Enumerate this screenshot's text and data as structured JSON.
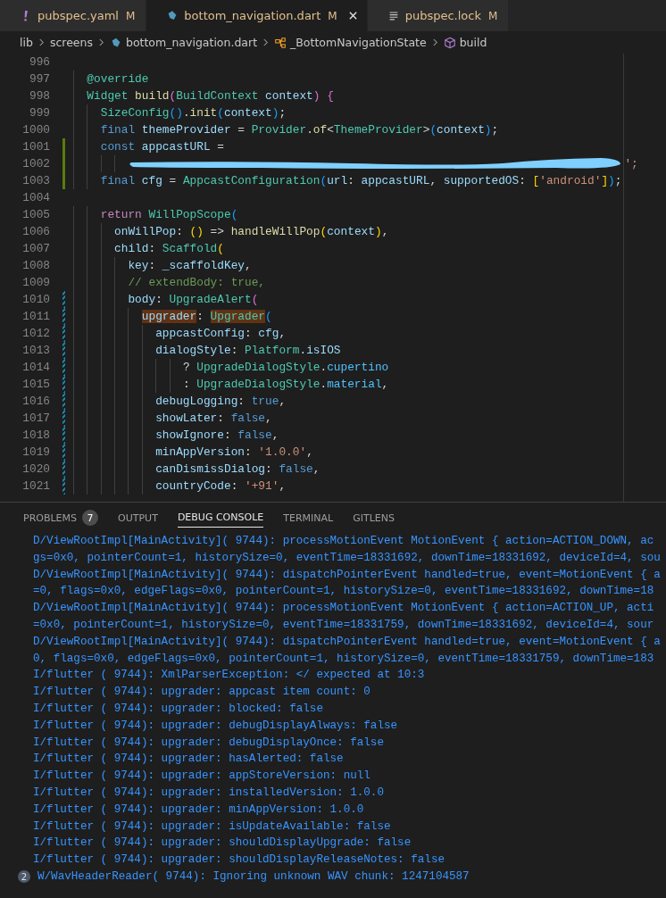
{
  "tabs": [
    {
      "label": "pubspec.yaml",
      "kind": "yaml",
      "status": "M",
      "selected": false
    },
    {
      "label": "bottom_navigation.dart",
      "kind": "dart",
      "status": "M",
      "selected": true
    },
    {
      "label": "pubspec.lock",
      "kind": "lock",
      "status": "M",
      "selected": false
    }
  ],
  "breadcrumbs": [
    {
      "label": "lib"
    },
    {
      "label": "screens"
    },
    {
      "label": "bottom_navigation.dart",
      "kind": "dart"
    },
    {
      "label": "_BottomNavigationState",
      "kind": "class"
    },
    {
      "label": "build",
      "kind": "method"
    }
  ],
  "editor": {
    "lines": [
      {
        "number": "996"
      },
      {
        "number": "997",
        "tokens": [
          {
            "text": "  @override",
            "kind": "type"
          }
        ]
      },
      {
        "number": "998",
        "tokens": [
          {
            "text": "  Widget",
            "kind": "type"
          },
          {
            "text": " build",
            "kind": "fn"
          },
          {
            "text": "(",
            "kind": "b2"
          },
          {
            "text": "BuildContext",
            "kind": "type"
          },
          {
            "text": " context",
            "kind": "var"
          },
          {
            "text": ")",
            "kind": "b2"
          },
          {
            "text": " {",
            "kind": "b2"
          }
        ]
      },
      {
        "number": "999",
        "tokens": [
          {
            "text": "    SizeConfig",
            "kind": "type"
          },
          {
            "text": "()",
            "kind": "b3"
          },
          {
            "text": ".",
            "kind": "plain"
          },
          {
            "text": "init",
            "kind": "fn"
          },
          {
            "text": "(",
            "kind": "b3"
          },
          {
            "text": "context",
            "kind": "var"
          },
          {
            "text": ")",
            "kind": "b3"
          },
          {
            "text": ";",
            "kind": "plain"
          }
        ]
      },
      {
        "number": "1000",
        "tokens": [
          {
            "text": "    final",
            "kind": "kw"
          },
          {
            "text": " themeProvider",
            "kind": "var"
          },
          {
            "text": " = ",
            "kind": "plain"
          },
          {
            "text": "Provider",
            "kind": "type"
          },
          {
            "text": ".",
            "kind": "plain"
          },
          {
            "text": "of",
            "kind": "fn"
          },
          {
            "text": "<",
            "kind": "plain"
          },
          {
            "text": "ThemeProvider",
            "kind": "type"
          },
          {
            "text": ">",
            "kind": "plain"
          },
          {
            "text": "(",
            "kind": "b3"
          },
          {
            "text": "context",
            "kind": "var"
          },
          {
            "text": ")",
            "kind": "b3"
          },
          {
            "text": ";",
            "kind": "plain"
          }
        ]
      },
      {
        "number": "1001",
        "kind": "added",
        "tokens": [
          {
            "text": "    const",
            "kind": "kw"
          },
          {
            "text": " appcastURL",
            "kind": "var"
          },
          {
            "text": " =",
            "kind": "plain"
          }
        ]
      },
      {
        "number": "1002",
        "kind": "added",
        "redacted": true,
        "tokens": [
          {
            "text": "        ';",
            "kind": "str"
          }
        ]
      },
      {
        "number": "1003",
        "kind": "added",
        "tokens": [
          {
            "text": "    final",
            "kind": "kw"
          },
          {
            "text": " cfg",
            "kind": "var"
          },
          {
            "text": " = ",
            "kind": "plain"
          },
          {
            "text": "AppcastConfiguration",
            "kind": "type"
          },
          {
            "text": "(",
            "kind": "b3"
          },
          {
            "text": "url",
            "kind": "var"
          },
          {
            "text": ": ",
            "kind": "plain"
          },
          {
            "text": "appcastURL",
            "kind": "var"
          },
          {
            "text": ", ",
            "kind": "plain"
          },
          {
            "text": "supportedOS",
            "kind": "var"
          },
          {
            "text": ": ",
            "kind": "plain"
          },
          {
            "text": "[",
            "kind": "b1"
          },
          {
            "text": "'android'",
            "kind": "str"
          },
          {
            "text": "]",
            "kind": "b1"
          },
          {
            "text": ")",
            "kind": "b3"
          },
          {
            "text": ";",
            "kind": "plain"
          }
        ]
      },
      {
        "number": "1004"
      },
      {
        "number": "1005",
        "tokens": [
          {
            "text": "    return",
            "kind": "ctrl"
          },
          {
            "text": " WillPopScope",
            "kind": "type"
          },
          {
            "text": "(",
            "kind": "b3"
          }
        ]
      },
      {
        "number": "1006",
        "tokens": [
          {
            "text": "      onWillPop",
            "kind": "var"
          },
          {
            "text": ": ",
            "kind": "plain"
          },
          {
            "text": "()",
            "kind": "b1"
          },
          {
            "text": " => ",
            "kind": "plain"
          },
          {
            "text": "handleWillPop",
            "kind": "fn"
          },
          {
            "text": "(",
            "kind": "b1"
          },
          {
            "text": "context",
            "kind": "var"
          },
          {
            "text": ")",
            "kind": "b1"
          },
          {
            "text": ",",
            "kind": "plain"
          }
        ]
      },
      {
        "number": "1007",
        "tokens": [
          {
            "text": "      child",
            "kind": "var"
          },
          {
            "text": ": ",
            "kind": "plain"
          },
          {
            "text": "Scaffold",
            "kind": "type"
          },
          {
            "text": "(",
            "kind": "b1"
          }
        ]
      },
      {
        "number": "1008",
        "tokens": [
          {
            "text": "        key",
            "kind": "var"
          },
          {
            "text": ": ",
            "kind": "plain"
          },
          {
            "text": "_scaffoldKey",
            "kind": "var"
          },
          {
            "text": ",",
            "kind": "plain"
          }
        ]
      },
      {
        "number": "1009",
        "tokens": [
          {
            "text": "        // extendBody: true,",
            "kind": "cmt"
          }
        ]
      },
      {
        "number": "1010",
        "kind": "modified",
        "tokens": [
          {
            "text": "        body",
            "kind": "var"
          },
          {
            "text": ": ",
            "kind": "plain"
          },
          {
            "text": "UpgradeAlert",
            "kind": "type"
          },
          {
            "text": "(",
            "kind": "b2"
          }
        ]
      },
      {
        "number": "1011",
        "kind": "modified",
        "tokens": [
          {
            "text": "          upgrader",
            "kind": "var",
            "highlight": true
          },
          {
            "text": ": ",
            "kind": "plain"
          },
          {
            "text": "Upgrader",
            "kind": "type",
            "highlight": true
          },
          {
            "text": "(",
            "kind": "b3"
          }
        ]
      },
      {
        "number": "1012",
        "kind": "modified",
        "tokens": [
          {
            "text": "            appcastConfig",
            "kind": "var"
          },
          {
            "text": ": ",
            "kind": "plain"
          },
          {
            "text": "cfg",
            "kind": "var"
          },
          {
            "text": ",",
            "kind": "plain"
          }
        ]
      },
      {
        "number": "1013",
        "kind": "modified",
        "tokens": [
          {
            "text": "            dialogStyle",
            "kind": "var"
          },
          {
            "text": ": ",
            "kind": "plain"
          },
          {
            "text": "Platform",
            "kind": "type"
          },
          {
            "text": ".",
            "kind": "plain"
          },
          {
            "text": "isIOS",
            "kind": "var"
          }
        ]
      },
      {
        "number": "1014",
        "kind": "modified",
        "tokens": [
          {
            "text": "                ? ",
            "kind": "plain"
          },
          {
            "text": "UpgradeDialogStyle",
            "kind": "type"
          },
          {
            "text": ".",
            "kind": "plain"
          },
          {
            "text": "cupertino",
            "kind": "prop"
          }
        ]
      },
      {
        "number": "1015",
        "kind": "modified",
        "tokens": [
          {
            "text": "                : ",
            "kind": "plain"
          },
          {
            "text": "UpgradeDialogStyle",
            "kind": "type"
          },
          {
            "text": ".",
            "kind": "plain"
          },
          {
            "text": "material",
            "kind": "prop"
          },
          {
            "text": ",",
            "kind": "plain"
          }
        ]
      },
      {
        "number": "1016",
        "kind": "modified",
        "tokens": [
          {
            "text": "            debugLogging",
            "kind": "var"
          },
          {
            "text": ": ",
            "kind": "plain"
          },
          {
            "text": "true",
            "kind": "kw"
          },
          {
            "text": ",",
            "kind": "plain"
          }
        ]
      },
      {
        "number": "1017",
        "kind": "modified",
        "tokens": [
          {
            "text": "            showLater",
            "kind": "var"
          },
          {
            "text": ": ",
            "kind": "plain"
          },
          {
            "text": "false",
            "kind": "kw"
          },
          {
            "text": ",",
            "kind": "plain"
          }
        ]
      },
      {
        "number": "1018",
        "kind": "modified",
        "tokens": [
          {
            "text": "            showIgnore",
            "kind": "var"
          },
          {
            "text": ": ",
            "kind": "plain"
          },
          {
            "text": "false",
            "kind": "kw"
          },
          {
            "text": ",",
            "kind": "plain"
          }
        ]
      },
      {
        "number": "1019",
        "kind": "modified",
        "tokens": [
          {
            "text": "            minAppVersion",
            "kind": "var"
          },
          {
            "text": ": ",
            "kind": "plain"
          },
          {
            "text": "'1.0.0'",
            "kind": "str"
          },
          {
            "text": ",",
            "kind": "plain"
          }
        ]
      },
      {
        "number": "1020",
        "kind": "modified",
        "tokens": [
          {
            "text": "            canDismissDialog",
            "kind": "var"
          },
          {
            "text": ": ",
            "kind": "plain"
          },
          {
            "text": "false",
            "kind": "kw"
          },
          {
            "text": ",",
            "kind": "plain"
          }
        ]
      },
      {
        "number": "1021",
        "kind": "modified",
        "tokens": [
          {
            "text": "            countryCode",
            "kind": "var"
          },
          {
            "text": ": ",
            "kind": "plain"
          },
          {
            "text": "'+91'",
            "kind": "str"
          },
          {
            "text": ",",
            "kind": "plain"
          }
        ]
      }
    ]
  },
  "panel": {
    "tabs": [
      {
        "label": "PROBLEMS",
        "badge": "7",
        "selected": false
      },
      {
        "label": "OUTPUT",
        "selected": false
      },
      {
        "label": "DEBUG CONSOLE",
        "selected": true
      },
      {
        "label": "TERMINAL",
        "selected": false
      },
      {
        "label": "GITLENS",
        "selected": false
      }
    ],
    "console": [
      {
        "text": "D/ViewRootImpl[MainActivity]( 9744): processMotionEvent MotionEvent { action=ACTION_DOWN, ac"
      },
      {
        "text": "gs=0x0, pointerCount=1, historySize=0, eventTime=18331692, downTime=18331692, deviceId=4, sou"
      },
      {
        "text": "D/ViewRootImpl[MainActivity]( 9744): dispatchPointerEvent handled=true, event=MotionEvent { a"
      },
      {
        "text": "=0, flags=0x0, edgeFlags=0x0, pointerCount=1, historySize=0, eventTime=18331692, downTime=18"
      },
      {
        "text": "D/ViewRootImpl[MainActivity]( 9744): processMotionEvent MotionEvent { action=ACTION_UP, acti"
      },
      {
        "text": "=0x0, pointerCount=1, historySize=0, eventTime=18331759, downTime=18331692, deviceId=4, sour"
      },
      {
        "text": "D/ViewRootImpl[MainActivity]( 9744): dispatchPointerEvent handled=true, event=MotionEvent { a"
      },
      {
        "text": "0, flags=0x0, edgeFlags=0x0, pointerCount=1, historySize=0, eventTime=18331759, downTime=183"
      },
      {
        "text": "I/flutter ( 9744): XmlParserException: </ expected at 10:3"
      },
      {
        "text": "I/flutter ( 9744): upgrader: appcast item count: 0"
      },
      {
        "text": "I/flutter ( 9744): upgrader: blocked: false"
      },
      {
        "text": "I/flutter ( 9744): upgrader: debugDisplayAlways: false"
      },
      {
        "text": "I/flutter ( 9744): upgrader: debugDisplayOnce: false"
      },
      {
        "text": "I/flutter ( 9744): upgrader: hasAlerted: false"
      },
      {
        "text": "I/flutter ( 9744): upgrader: appStoreVersion: null"
      },
      {
        "text": "I/flutter ( 9744): upgrader: installedVersion: 1.0.0"
      },
      {
        "text": "I/flutter ( 9744): upgrader: minAppVersion: 1.0.0"
      },
      {
        "text": "I/flutter ( 9744): upgrader: isUpdateAvailable: false"
      },
      {
        "text": "I/flutter ( 9744): upgrader: shouldDisplayUpgrade: false"
      },
      {
        "text": "I/flutter ( 9744): upgrader: shouldDisplayReleaseNotes: false"
      },
      {
        "text": "W/WavHeaderReader( 9744): Ignoring unknown WAV chunk: 1247104587",
        "count": "2"
      }
    ]
  }
}
